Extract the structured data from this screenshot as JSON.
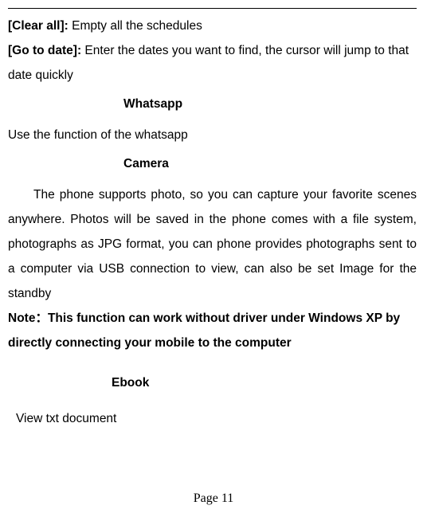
{
  "definitions": {
    "clear_all": {
      "label": "[Clear all]:",
      "text": " Empty all the schedules"
    },
    "go_to_date": {
      "label": "[Go to date]:",
      "text": " Enter the dates you want to find, the cursor will jump to that date quickly"
    }
  },
  "sections": {
    "whatsapp": {
      "heading": "Whatsapp",
      "body": "Use the function of the whatsapp"
    },
    "camera": {
      "heading": "Camera",
      "body": "The phone supports photo, so you can capture your favorite scenes anywhere. Photos will be saved in the phone comes with a file system, photographs as JPG format, you can phone provides photographs sent to a computer via USB connection to view, can also be set Image for the standby",
      "note": "Note：This function can work without driver under Windows XP by directly connecting your mobile to the computer"
    },
    "ebook": {
      "heading": "Ebook",
      "body": "View txt document"
    }
  },
  "page_number": "Page 11"
}
